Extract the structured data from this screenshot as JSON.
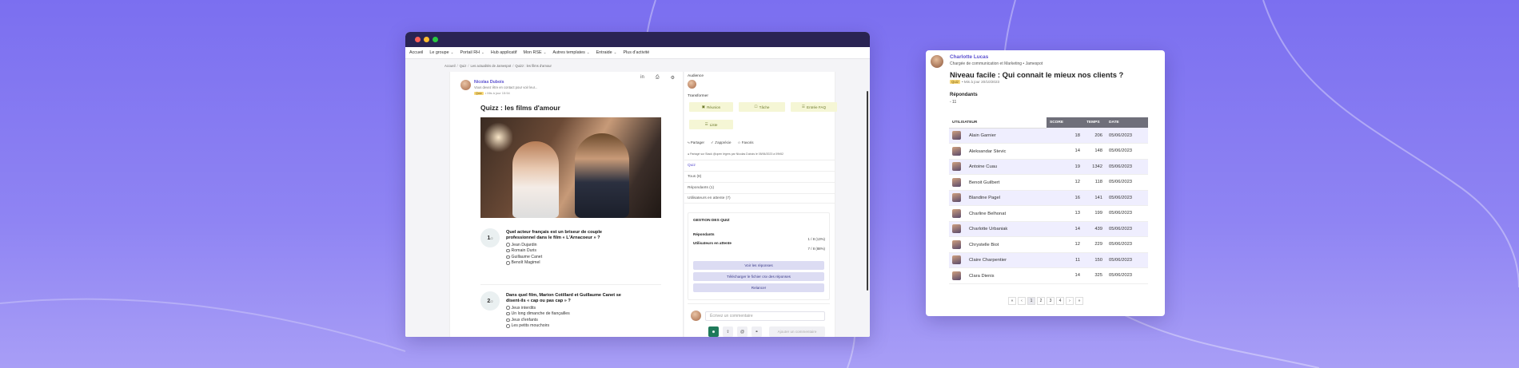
{
  "window": {
    "menu": [
      {
        "label": "Accueil",
        "dropdown": false
      },
      {
        "label": "Le groupe",
        "dropdown": true
      },
      {
        "label": "Portail RH",
        "dropdown": true
      },
      {
        "label": "Hub applicatif",
        "dropdown": false
      },
      {
        "label": "Mon RSE",
        "dropdown": true
      },
      {
        "label": "Autres templates",
        "dropdown": true
      },
      {
        "label": "Entraide",
        "dropdown": true
      },
      {
        "label": "Plus d'activité",
        "dropdown": false
      }
    ],
    "breadcrumb": [
      "Accueil",
      "Quiz",
      "Les actualités de Jamespot",
      "Quizz : les films d'amour"
    ]
  },
  "post": {
    "author_name": "Nicolas Dubois",
    "author_sub": "Vous devez être en contact pour voir leur...",
    "tag": "Quiz",
    "meta": "• Mis à jour 15:54",
    "title": "Quizz : les films d'amour",
    "questions": [
      {
        "num": "1",
        "total": "/2",
        "text": "Quel acteur français est un briseur de couple professionnel dans le film « L'Arnacoeur » ?",
        "options": [
          "Jean Dujardin",
          "Romain Duris",
          "Guillaume Canet",
          "Benoît Magimel"
        ]
      },
      {
        "num": "2",
        "total": "/2",
        "text": "Dans quel film, Marion Cotillard et Guillaume Canet se disent-ils « cap ou pas cap » ?",
        "options": [
          "Jeux interdits",
          "Un long dimanche de fiançailles",
          "Jeux d'enfants",
          "Les petits mouchoirs"
        ]
      }
    ]
  },
  "side": {
    "audience_label": "Audience",
    "transform_label": "Transformer",
    "transform_buttons": [
      "Réunion",
      "Tâche",
      "Entrée FAQ",
      "Liste"
    ],
    "actions": [
      "Partager",
      "J'apprécie",
      "Favoris"
    ],
    "share_note": "Partagé sur Stack @open légers par Nicolas Dubois le 05/06/2023 à 09h52",
    "tabs": [
      "Quiz",
      "Tous (8)",
      "Répondants (1)",
      "Utilisateurs en attente (7)"
    ],
    "gestion": {
      "title": "GESTION DES QUIZ",
      "repondants_label": "Répondants",
      "repondants_value": "1 / 8 (13%)",
      "attente_label": "Utilisateurs en attente",
      "attente_value": "7 / 8 (88%)",
      "buttons": [
        "Voir les réponses",
        "Télécharger le fichier csv des réponses",
        "Relancer"
      ]
    },
    "comment_placeholder": "Écrivez un commentaire",
    "send_label": "Ajouter un commentaire"
  },
  "card": {
    "name": "Charlotte Lucas",
    "subtitle": "Chargée de communication et Marketing  •  Jamespot",
    "title": "Niveau facile : Qui connait le mieux nos clients ?",
    "tag": "Quiz",
    "meta": "• Mis à jour 20/10/2023",
    "repondants_label": "Répondants",
    "repondants_value": "- 11",
    "columns": [
      "UTILISATEUR",
      "SCORE",
      "TEMPS",
      "DATE"
    ],
    "rows": [
      {
        "name": "Alain Garnier",
        "score": "18",
        "time": "206",
        "date": "05/06/2023"
      },
      {
        "name": "Aleksandar Stevic",
        "score": "14",
        "time": "148",
        "date": "05/06/2023"
      },
      {
        "name": "Antoine Cuau",
        "score": "19",
        "time": "1342",
        "date": "05/06/2023"
      },
      {
        "name": "Benoit Guilbert",
        "score": "12",
        "time": "118",
        "date": "05/06/2023"
      },
      {
        "name": "Blandine Pagel",
        "score": "16",
        "time": "141",
        "date": "05/06/2023"
      },
      {
        "name": "Charline Belhonat",
        "score": "13",
        "time": "199",
        "date": "05/06/2023"
      },
      {
        "name": "Charlotte Urbaniak",
        "score": "14",
        "time": "439",
        "date": "05/06/2023"
      },
      {
        "name": "Chrystelle Biot",
        "score": "12",
        "time": "229",
        "date": "05/06/2023"
      },
      {
        "name": "Claire Charpentier",
        "score": "11",
        "time": "150",
        "date": "05/06/2023"
      },
      {
        "name": "Clara Dienis",
        "score": "14",
        "time": "325",
        "date": "05/06/2023"
      }
    ],
    "pager": [
      "«",
      "‹",
      "1",
      "2",
      "3",
      "4",
      "›",
      "»"
    ],
    "current_page": "1"
  },
  "colors": {
    "background": "#7b6ff0",
    "window_titlebar": "#2a2453",
    "accent": "#5a4fcf",
    "table_header": "#6f6f7a",
    "row_alt": "#efeefe"
  }
}
